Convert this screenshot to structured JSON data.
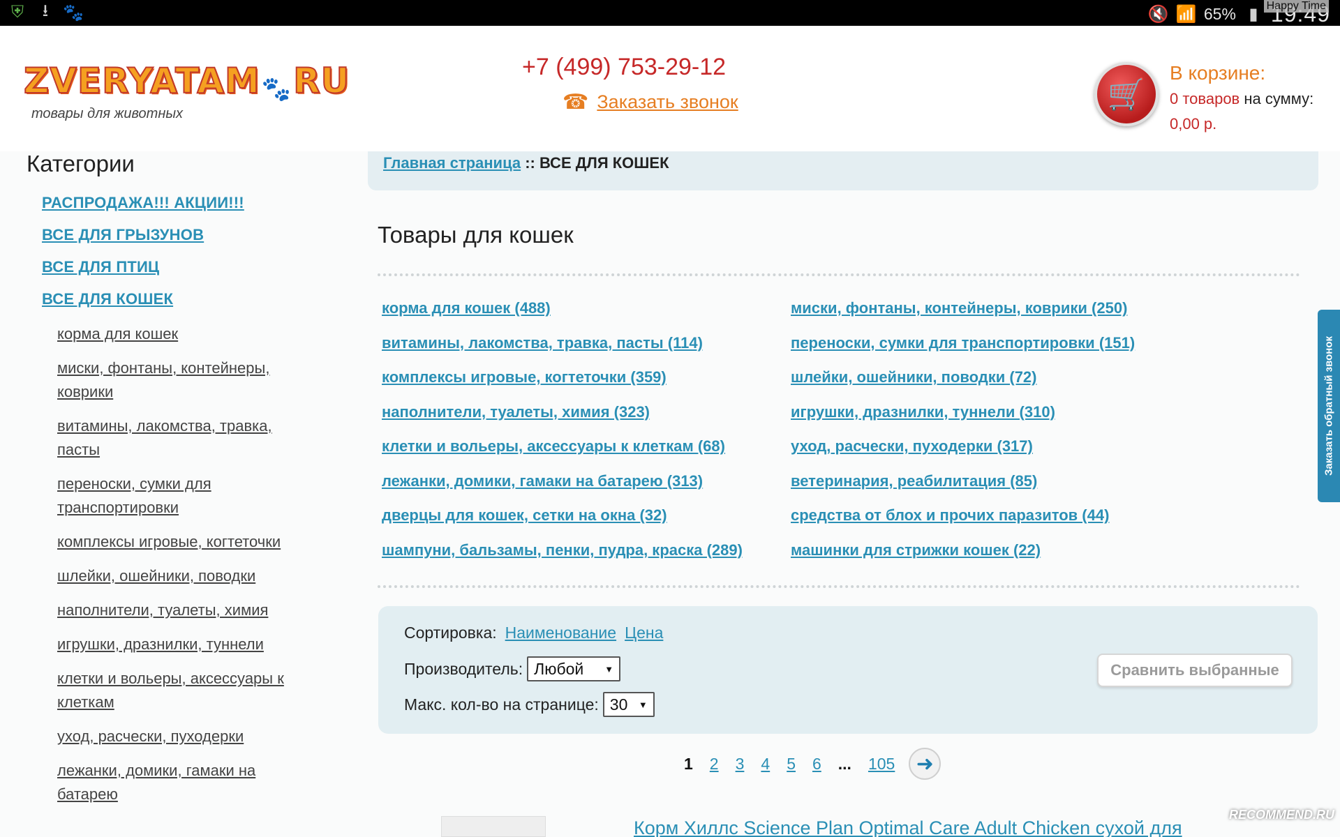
{
  "status_bar": {
    "left_icons": [
      "shield-icon",
      "download-icon",
      "cat-app-icon"
    ],
    "battery_percent": "65%",
    "time": "19:49",
    "overlay_text": "Happy Time"
  },
  "header": {
    "logo_text_1": "ZVERYATAM",
    "logo_text_2": "RU",
    "tagline": "товары для животных",
    "phone": "+7 (499) 753-29-12",
    "callback_label": "Заказать звонок",
    "cart_title": "В корзине:",
    "cart_items": "0 товаров",
    "cart_sum_label": "на сумму:",
    "cart_sum": "0,00 р."
  },
  "sidebar": {
    "title": "Категории",
    "top_items": [
      "РАСПРОДАЖА!!! АКЦИИ!!!",
      "ВСЕ ДЛЯ ГРЫЗУНОВ",
      "ВСЕ ДЛЯ ПТИЦ",
      "ВСЕ ДЛЯ КОШЕК"
    ],
    "sub_items": [
      "корма для кошек",
      "миски, фонтаны, контейнеры, коврики",
      "витамины, лакомства, травка, пасты",
      "переноски, сумки для транспортировки",
      "комплексы игровые, когтеточки",
      "шлейки, ошейники, поводки",
      "наполнители, туалеты, химия",
      "игрушки, дразнилки, туннели",
      "клетки и вольеры, аксессуары к клеткам",
      "уход, расчески, пуходерки",
      "лежанки, домики, гамаки на батарею"
    ]
  },
  "main": {
    "breadcrumb_home": "Главная страница",
    "breadcrumb_sep": " :: ",
    "breadcrumb_current": "ВСЕ ДЛЯ КОШЕК",
    "page_title": "Товары для кошек",
    "subcategories": [
      "корма для кошек (488)",
      "миски, фонтаны, контейнеры, коврики (250)",
      "витамины, лакомства, травка, пасты (114)",
      "переноски, сумки для транспортировки (151)",
      "комплексы игровые, когтеточки (359)",
      "шлейки, ошейники, поводки (72)",
      "наполнители, туалеты, химия (323)",
      "игрушки, дразнилки, туннели (310)",
      "клетки и вольеры, аксессуары к клеткам (68)",
      "уход, расчески, пуходерки (317)",
      "лежанки, домики, гамаки на батарею (313)",
      "ветеринария, реабилитация (85)",
      "дверцы для кошек, сетки на окна (32)",
      "средства от блох и прочих паразитов (44)",
      "шампуни, бальзамы, пенки, пудра, краска (289)",
      "машинки для стрижки кошек (22)"
    ],
    "sort_label": "Сортировка:",
    "sort_name": "Наименование",
    "sort_price": "Цена",
    "manufacturer_label": "Производитель:",
    "manufacturer_value": "Любой",
    "per_page_label": "Макс. кол-во на странице:",
    "per_page_value": "30",
    "compare_button": "Сравнить выбранные",
    "pagination": [
      "1",
      "2",
      "3",
      "4",
      "5",
      "6",
      "...",
      "105"
    ],
    "product_title": "Корм Хиллс Science Plan Optimal Care Adult Chicken сухой для"
  },
  "side_tab": "Заказать обратный звонок",
  "watermark": "RECOMMEND.RU",
  "colors": {
    "link": "#2a8fb5",
    "accent_orange": "#e67e22",
    "red": "#c62828",
    "panel": "#e2eef2"
  }
}
